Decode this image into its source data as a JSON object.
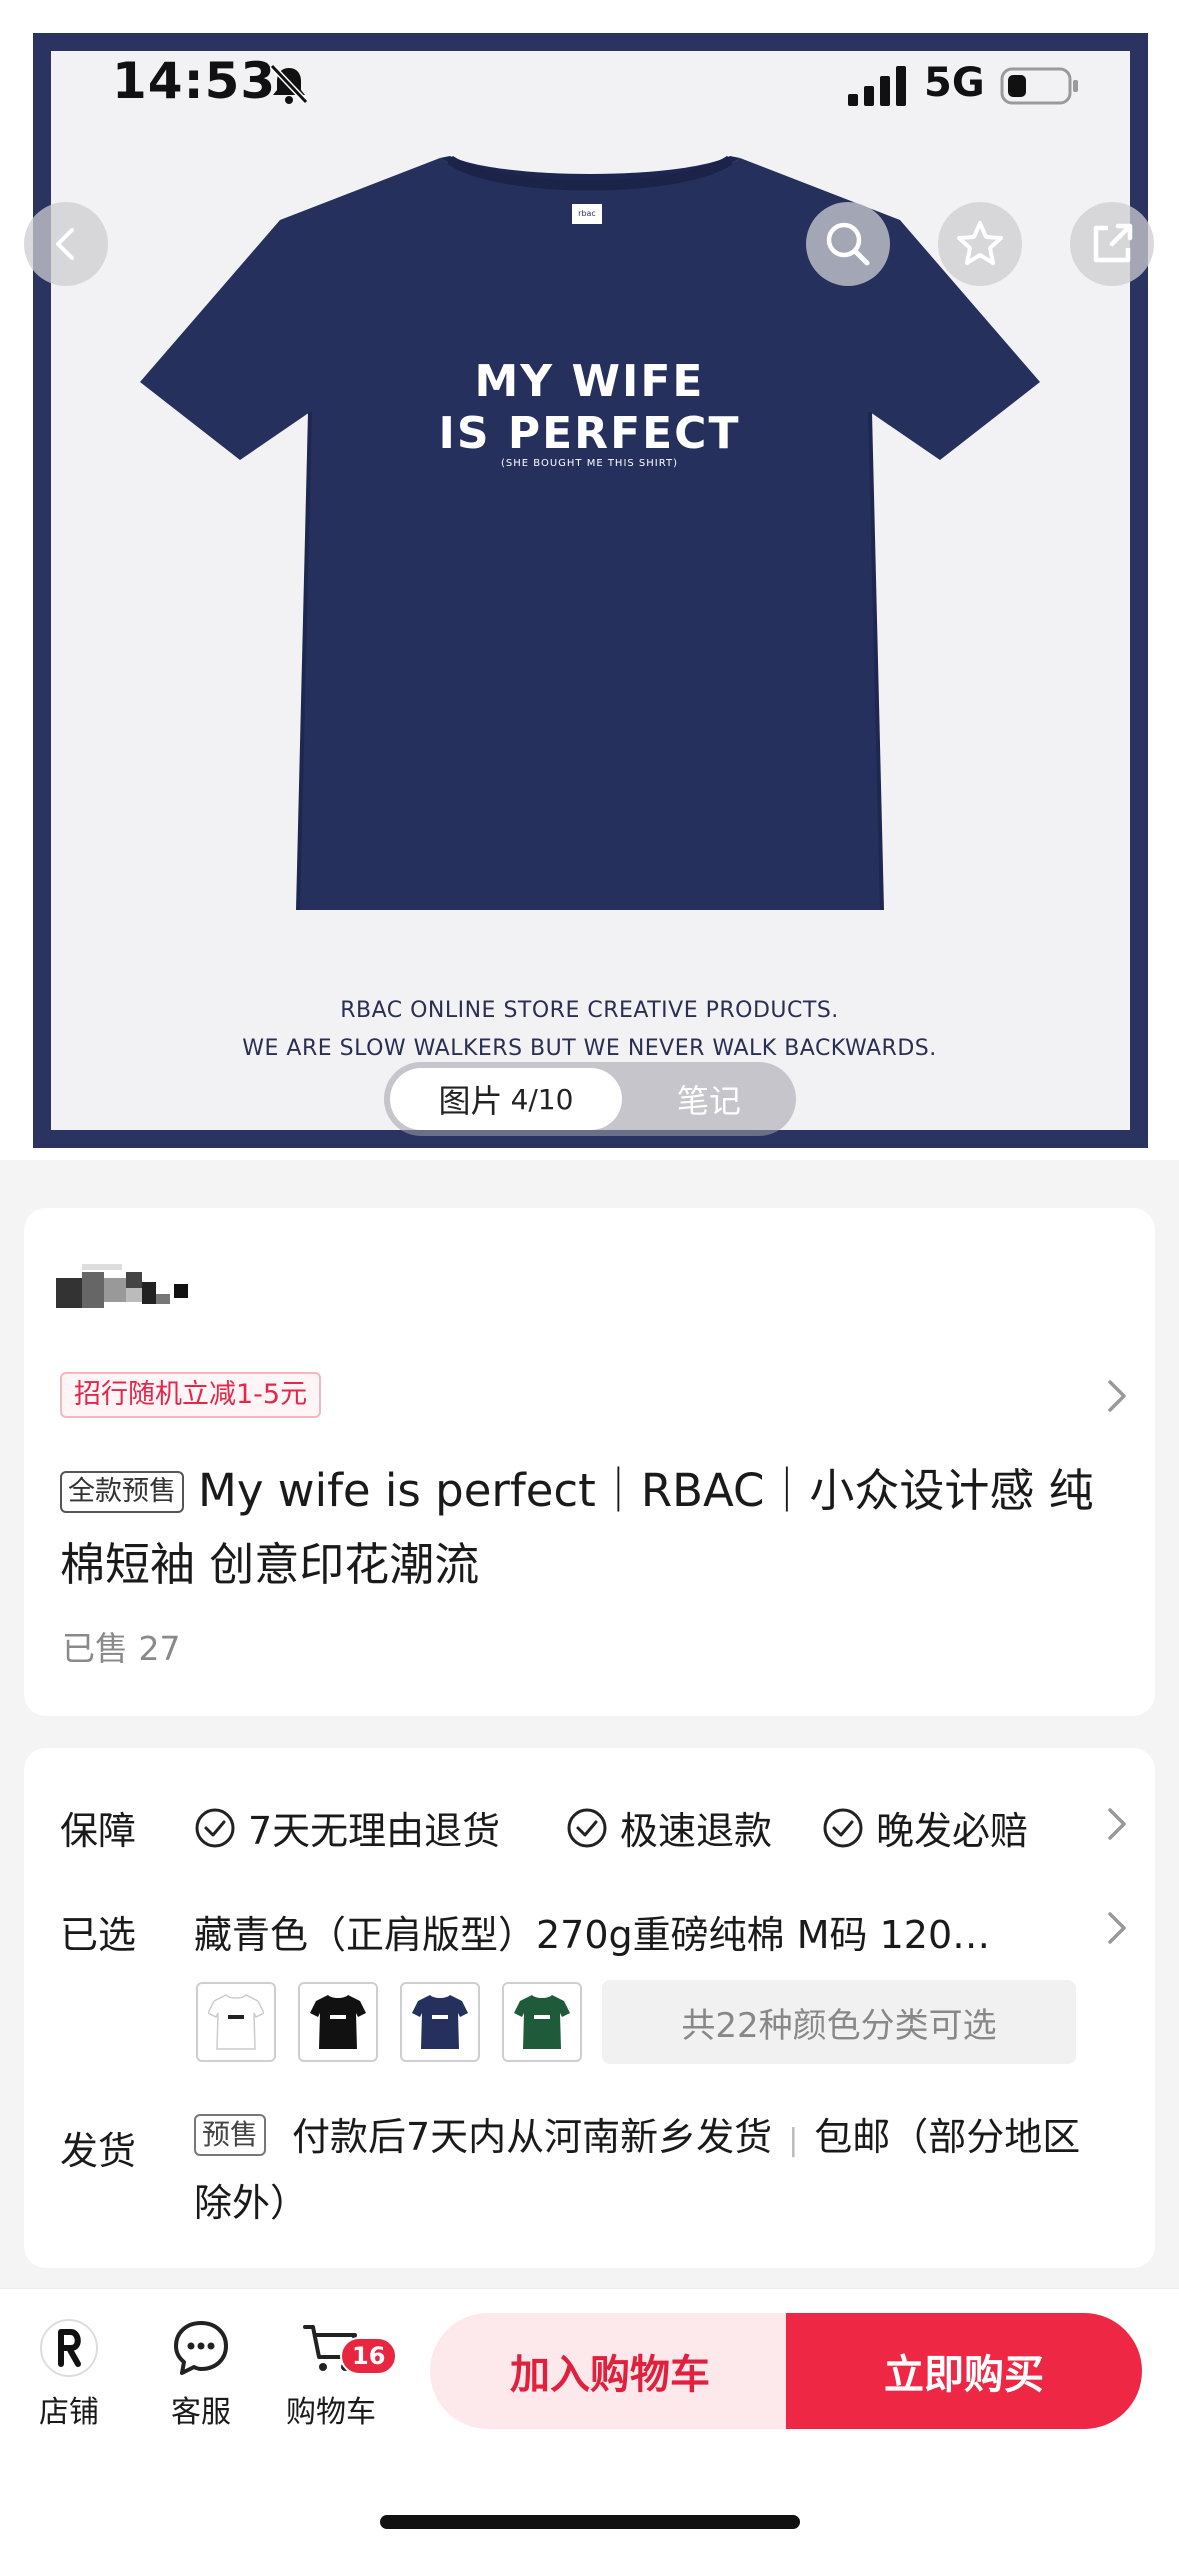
{
  "status_bar": {
    "time": "14:53",
    "network": "5G",
    "icons": [
      "bell-muted-icon",
      "signal-icon",
      "battery-icon"
    ]
  },
  "top_nav": {
    "icons": [
      "back-icon",
      "search-icon",
      "star-icon",
      "share-icon"
    ]
  },
  "product_image": {
    "shirt_line1": "MY WIFE",
    "shirt_line2": "IS PERFECT",
    "shirt_line3": "(SHE BOUGHT ME THIS SHIRT)",
    "slogan1": "RBAC ONLINE STORE CREATIVE PRODUCTS.",
    "slogan2": "WE ARE SLOW WALKERS BUT WE NEVER WALK BACKWARDS.",
    "pager_label": "图片",
    "pager_count": "4/10",
    "pager_other": "笔记"
  },
  "product": {
    "promo": "招行随机立减1-5元",
    "badge": "全款预售",
    "title": "My wife is perfect｜RBAC｜小众设计感 纯棉短袖 创意印花潮流",
    "sold": "已售 27"
  },
  "options": {
    "guarantee_label": "保障",
    "guarantees": [
      "7天无理由退货",
      "极速退款",
      "晚发必赔"
    ],
    "selected_label": "已选",
    "selected_value": "藏青色（正肩版型）270g重磅纯棉 M码 120…",
    "thumbnail_colors": [
      "#ffffff",
      "#111111",
      "#26305c",
      "#1f5a3a"
    ],
    "more_colors": "共22种颜色分类可选",
    "shipping_label": "发货",
    "shipping_badge": "预售",
    "shipping_text": "付款后7天内从河南新乡发货",
    "shipping_free": "包邮（部分地区除外）"
  },
  "bottom_bar": {
    "store": "店铺",
    "service": "客服",
    "cart": "购物车",
    "cart_count": "16",
    "add_to_cart": "加入购物车",
    "buy_now": "立即购买"
  },
  "colors": {
    "accent": "#ee2745",
    "accent_light": "#fde9ec",
    "frame": "#2b3361",
    "shirt": "#25305d"
  }
}
